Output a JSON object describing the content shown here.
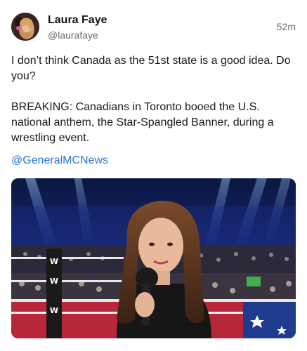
{
  "post": {
    "author": {
      "display_name": "Laura Faye",
      "handle": "@laurafaye",
      "avatar_icon": "profile-photo"
    },
    "timestamp": "52m",
    "paragraphs": [
      "I don’t think Canada as the 51st state is a good idea. Do you?",
      "BREAKING: Canadians in Toronto booed the U.S. national anthem, the Star-Spangled Banner, during a wrestling event."
    ],
    "mention": "@GeneralMCNews",
    "media": {
      "kind": "photo",
      "subject_icon": "woman-singing-with-microphone-in-arena"
    }
  },
  "colors": {
    "link": "#2d78d2",
    "secondary_text": "#6b6b6b",
    "primary_text": "#1a1a1a"
  }
}
